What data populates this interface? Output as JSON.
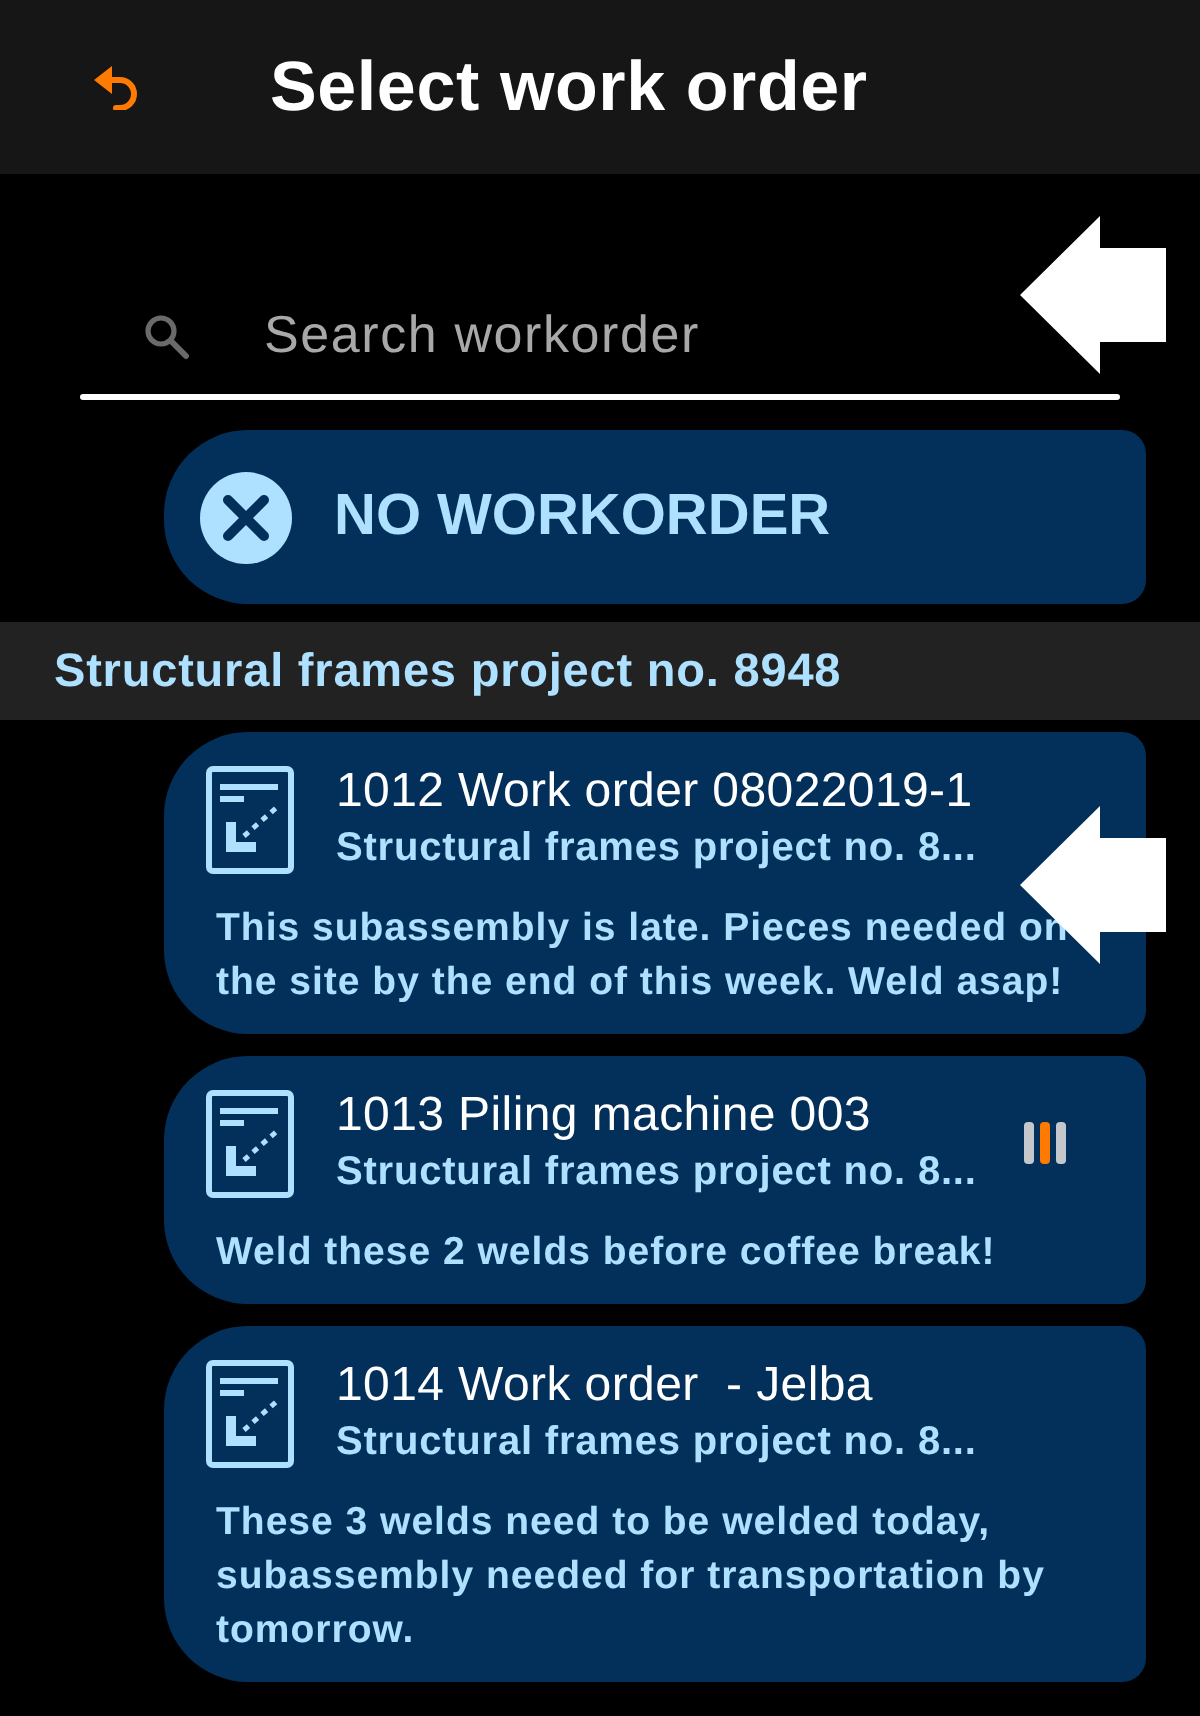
{
  "header": {
    "title": "Select work order"
  },
  "search": {
    "placeholder": "Search workorder",
    "pointer_arrow": true
  },
  "no_workorder_button": {
    "label": "NO WORKORDER"
  },
  "section": {
    "title": "Structural frames project no. 8948"
  },
  "work_orders": [
    {
      "title": "1012 Work order 08022019-1",
      "project": "Structural frames project no. 8...",
      "note": "This subassembly is late. Pieces needed on the site by the end of this week. Weld asap!",
      "status_icon": false,
      "pointer_arrow": true
    },
    {
      "title": "1013 Piling machine 003",
      "project": "Structural frames project no. 8...",
      "note": "Weld these 2 welds before coffee break!",
      "status_icon": true,
      "pointer_arrow": false
    },
    {
      "title": "1014 Work order  - Jelba",
      "project": "Structural frames project no. 8...",
      "note": "These 3 welds need to be welded today, subassembly needed for transportation by tomorrow.",
      "status_icon": false,
      "pointer_arrow": false
    }
  ]
}
